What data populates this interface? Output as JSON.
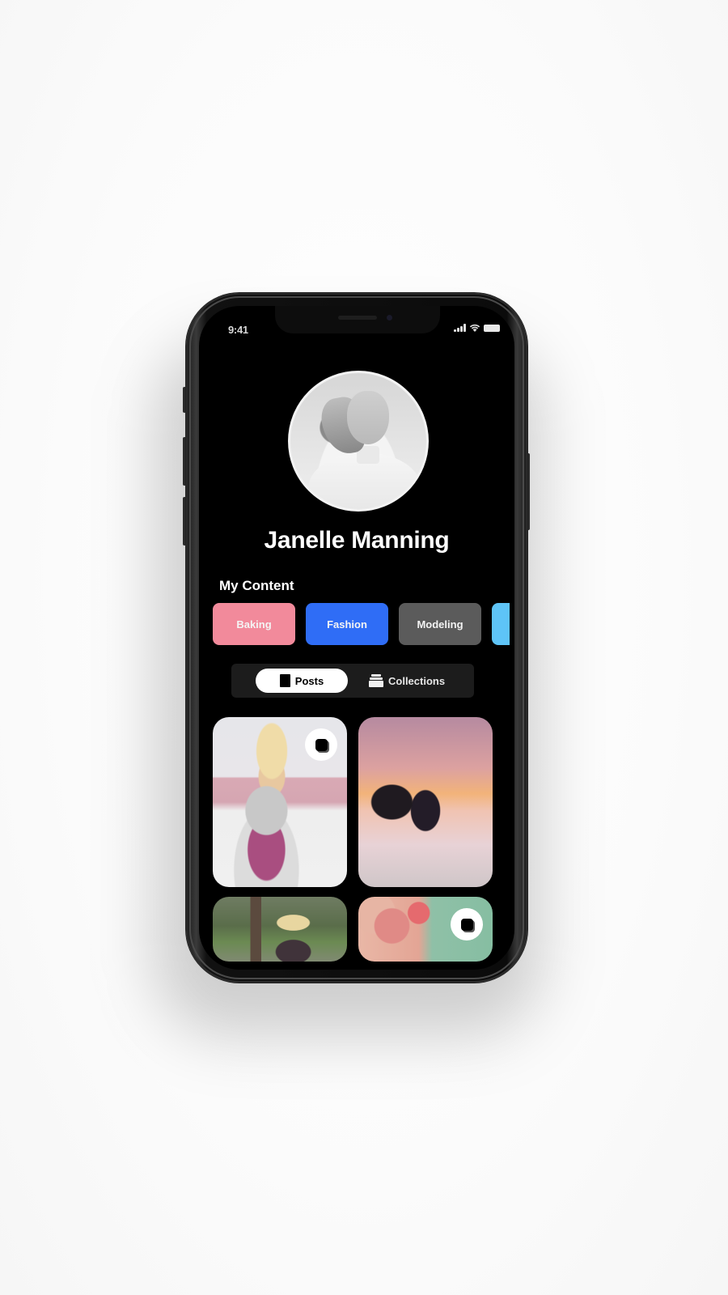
{
  "status_bar": {
    "time": "9:41",
    "icons": [
      "cellular-signal-icon",
      "wifi-icon",
      "battery-icon"
    ]
  },
  "profile": {
    "name": "Janelle Manning",
    "avatar": "profile-photo"
  },
  "content_section": {
    "title": "My Content",
    "categories": [
      {
        "label": "Baking",
        "color": "#f28a9b"
      },
      {
        "label": "Fashion",
        "color": "#2f6df6"
      },
      {
        "label": "Modeling",
        "color": "#5b5b5b"
      },
      {
        "label": "",
        "color": "#5ec4f7"
      }
    ]
  },
  "view_toggle": {
    "tabs": [
      {
        "label": "Posts",
        "icon": "single-post-icon",
        "active": true
      },
      {
        "label": "Collections",
        "icon": "stack-icon",
        "active": false
      }
    ]
  },
  "posts": [
    {
      "description": "woman with pink floral cake",
      "multi": true
    },
    {
      "description": "two silhouettes at sunset over water",
      "multi": false
    },
    {
      "description": "blonde woman in park",
      "multi": false
    },
    {
      "description": "pink flowers bouquet",
      "multi": true
    }
  ],
  "colors": {
    "screen_background": "#000000",
    "segmented_background": "#1c1c1c",
    "active_tab": "#ffffff"
  }
}
